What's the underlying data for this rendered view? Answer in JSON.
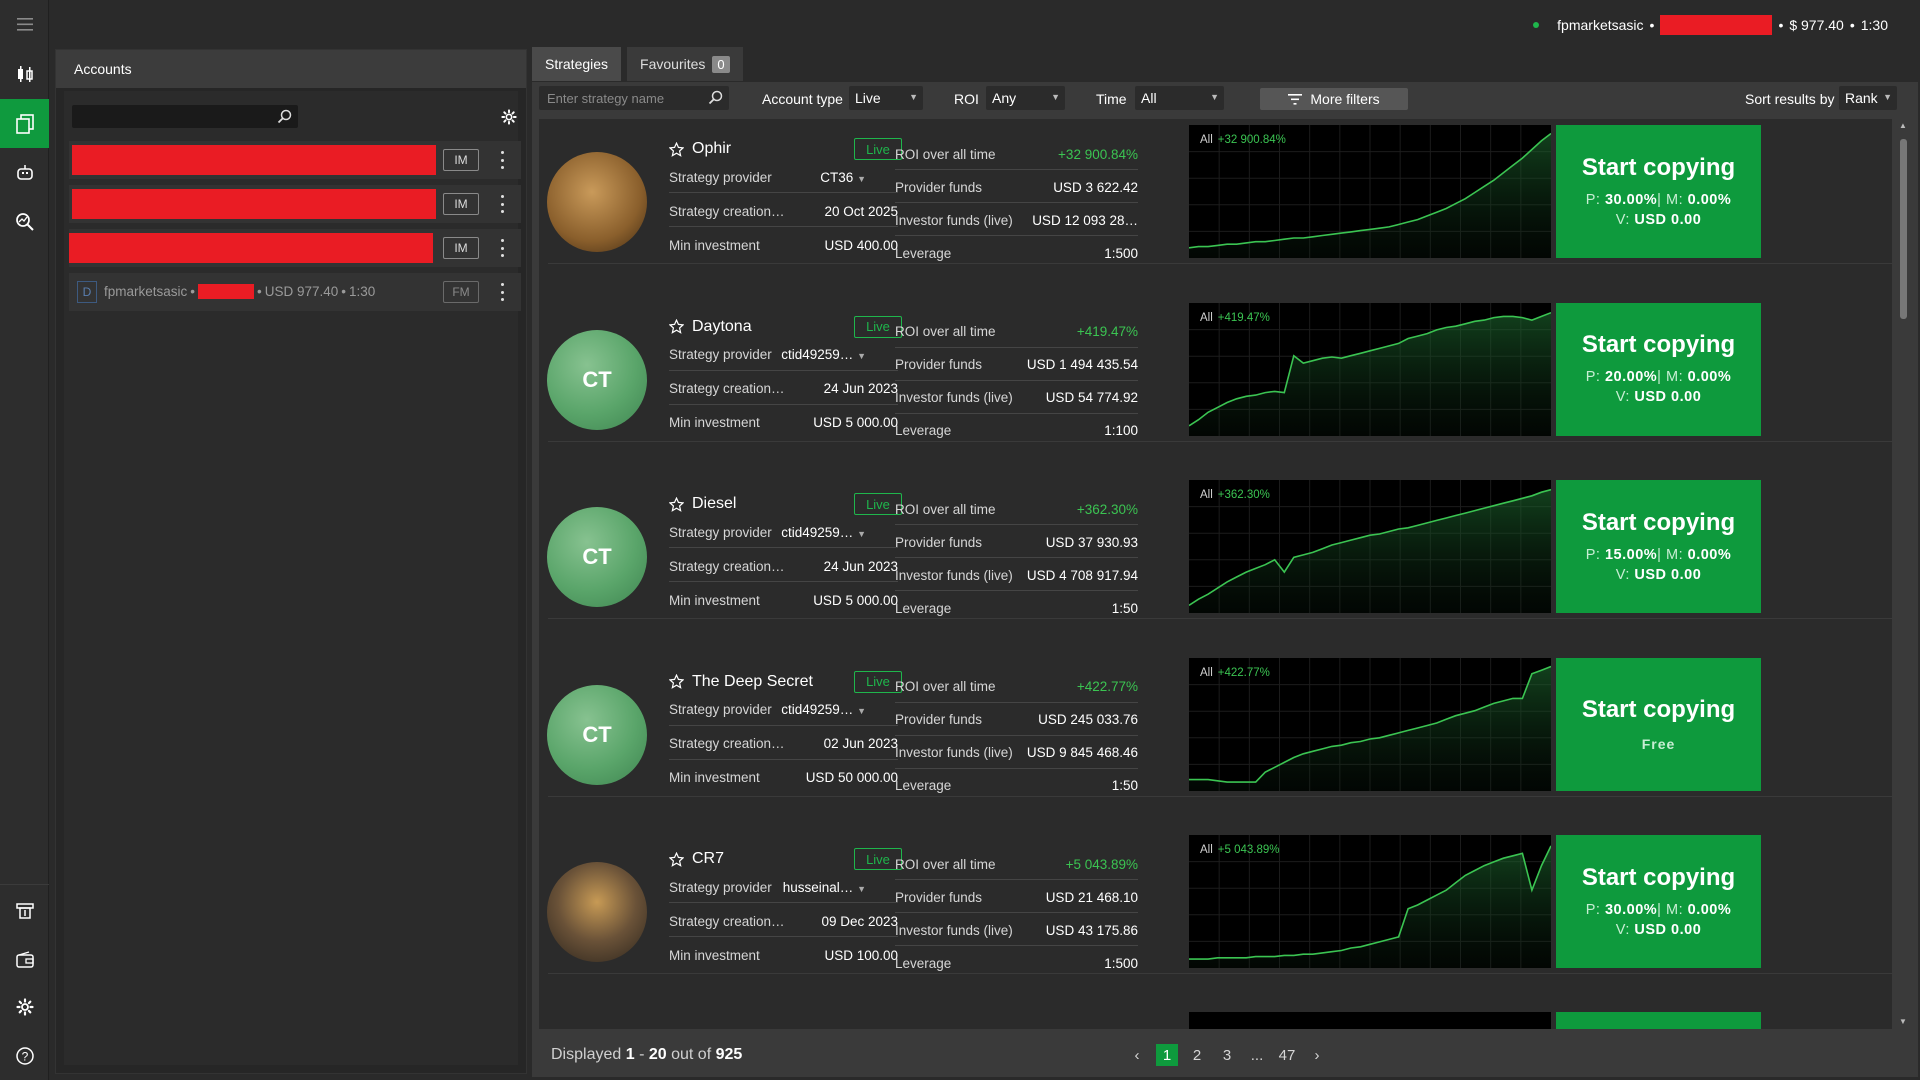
{
  "topbar": {
    "account_name": "fpmarketsasic",
    "separator": "•",
    "balance": "$ 977.40",
    "leverage": "1:30"
  },
  "accounts_panel": {
    "title": "Accounts",
    "rows": [
      {
        "tag": "IM"
      },
      {
        "tag": "IM"
      },
      {
        "tag": "IM"
      }
    ],
    "fm_account": {
      "icon_letter": "D",
      "name": "fpmarketsasic",
      "balance": "USD 977.40",
      "leverage": "1:30",
      "tag": "FM"
    }
  },
  "tabs": [
    {
      "label": "Strategies"
    },
    {
      "label": "Favourites",
      "count": "0"
    }
  ],
  "filters": {
    "search_placeholder": "Enter strategy name",
    "account_type_label": "Account type",
    "account_type_value": "Live",
    "roi_label": "ROI",
    "roi_value": "Any",
    "time_label": "Time",
    "time_value": "All",
    "more_filters": "More filters",
    "sort_label": "Sort results by",
    "sort_value": "Rank"
  },
  "labels": {
    "provider": "Strategy provider",
    "creation": "Strategy creation…",
    "min_inv": "Min investment",
    "roi_all": "ROI over all time",
    "provider_funds": "Provider funds",
    "investor_funds": "Investor funds (live)",
    "leverage": "Leverage",
    "chart_all": "All",
    "start": "Start copying",
    "live": "Live",
    "p": "P:",
    "m": "M:",
    "v": "V:",
    "free": "Free"
  },
  "strategies": [
    {
      "name": "Ophir",
      "avatar": "coin",
      "avatar_text": "",
      "provider": "CT36",
      "creation": "20 Oct 2025",
      "min_inv": "USD 400.00",
      "roi": "+32 900.84%",
      "provider_funds": "USD 3 622.42",
      "investor_funds": "USD 12 093 28…",
      "leverage": "1:500",
      "p": "30.00%",
      "m": "0.00%",
      "v": "USD 0.00",
      "free": false,
      "curve": [
        0.05,
        0.06,
        0.06,
        0.07,
        0.08,
        0.08,
        0.09,
        0.1,
        0.1,
        0.11,
        0.12,
        0.13,
        0.13,
        0.14,
        0.15,
        0.16,
        0.17,
        0.18,
        0.19,
        0.2,
        0.21,
        0.22,
        0.24,
        0.26,
        0.28,
        0.31,
        0.34,
        0.37,
        0.41,
        0.45,
        0.5,
        0.55,
        0.6,
        0.66,
        0.72,
        0.78,
        0.85,
        0.92,
        0.98
      ]
    },
    {
      "name": "Daytona",
      "avatar": "ct",
      "avatar_text": "CT",
      "provider": "ctid49259…",
      "creation": "24 Jun 2023",
      "min_inv": "USD 5 000.00",
      "roi": "+419.47%",
      "provider_funds": "USD 1 494 435.54",
      "investor_funds": "USD 54 774.92",
      "leverage": "1:100",
      "p": "20.00%",
      "m": "0.00%",
      "v": "USD 0.00",
      "free": false,
      "curve": [
        0.05,
        0.1,
        0.16,
        0.2,
        0.24,
        0.27,
        0.29,
        0.3,
        0.32,
        0.33,
        0.32,
        0.62,
        0.56,
        0.58,
        0.6,
        0.61,
        0.6,
        0.62,
        0.64,
        0.66,
        0.68,
        0.7,
        0.72,
        0.76,
        0.78,
        0.8,
        0.83,
        0.85,
        0.86,
        0.88,
        0.9,
        0.91,
        0.93,
        0.94,
        0.94,
        0.93,
        0.91,
        0.94,
        0.97
      ]
    },
    {
      "name": "Diesel",
      "avatar": "ct",
      "avatar_text": "CT",
      "provider": "ctid49259…",
      "creation": "24 Jun 2023",
      "min_inv": "USD 5 000.00",
      "roi": "+362.30%",
      "provider_funds": "USD 37 930.93",
      "investor_funds": "USD 4 708 917.94",
      "leverage": "1:50",
      "p": "15.00%",
      "m": "0.00%",
      "v": "USD 0.00",
      "free": false,
      "curve": [
        0.03,
        0.08,
        0.12,
        0.17,
        0.22,
        0.26,
        0.3,
        0.33,
        0.36,
        0.4,
        0.3,
        0.42,
        0.44,
        0.46,
        0.49,
        0.52,
        0.54,
        0.56,
        0.58,
        0.6,
        0.61,
        0.63,
        0.65,
        0.66,
        0.68,
        0.7,
        0.72,
        0.74,
        0.76,
        0.78,
        0.8,
        0.82,
        0.84,
        0.86,
        0.88,
        0.9,
        0.92,
        0.95,
        0.97
      ]
    },
    {
      "name": "The Deep Secret",
      "avatar": "ct",
      "avatar_text": "CT",
      "provider": "ctid49259…",
      "creation": "02 Jun 2023",
      "min_inv": "USD 50 000.00",
      "roi": "+422.77%",
      "provider_funds": "USD 245 033.76",
      "investor_funds": "USD 9 845 468.46",
      "leverage": "1:50",
      "p": "",
      "m": "",
      "v": "",
      "free": true,
      "curve": [
        0.06,
        0.06,
        0.06,
        0.05,
        0.04,
        0.04,
        0.04,
        0.04,
        0.12,
        0.16,
        0.2,
        0.24,
        0.27,
        0.29,
        0.31,
        0.33,
        0.34,
        0.36,
        0.37,
        0.39,
        0.4,
        0.42,
        0.44,
        0.46,
        0.48,
        0.5,
        0.52,
        0.55,
        0.58,
        0.6,
        0.62,
        0.65,
        0.68,
        0.7,
        0.72,
        0.72,
        0.92,
        0.95,
        0.98
      ]
    },
    {
      "name": "CR7",
      "avatar": "photo",
      "avatar_text": "",
      "provider": "husseinal…",
      "creation": "09 Dec 2023",
      "min_inv": "USD 100.00",
      "roi": "+5 043.89%",
      "provider_funds": "USD 21 468.10",
      "investor_funds": "USD 43 175.86",
      "leverage": "1:500",
      "p": "30.00%",
      "m": "0.00%",
      "v": "USD 0.00",
      "free": false,
      "curve": [
        0.04,
        0.04,
        0.04,
        0.05,
        0.05,
        0.05,
        0.05,
        0.06,
        0.06,
        0.06,
        0.07,
        0.07,
        0.08,
        0.08,
        0.09,
        0.1,
        0.11,
        0.13,
        0.14,
        0.16,
        0.18,
        0.2,
        0.22,
        0.45,
        0.48,
        0.52,
        0.56,
        0.6,
        0.66,
        0.72,
        0.76,
        0.8,
        0.83,
        0.86,
        0.88,
        0.9,
        0.6,
        0.8,
        0.96
      ]
    }
  ],
  "footer": {
    "displayed": "Displayed",
    "from": "1",
    "dash": "-",
    "to": "20",
    "out_of": "out of",
    "total": "925",
    "pages": [
      "1",
      "2",
      "3",
      "...",
      "47"
    ]
  }
}
